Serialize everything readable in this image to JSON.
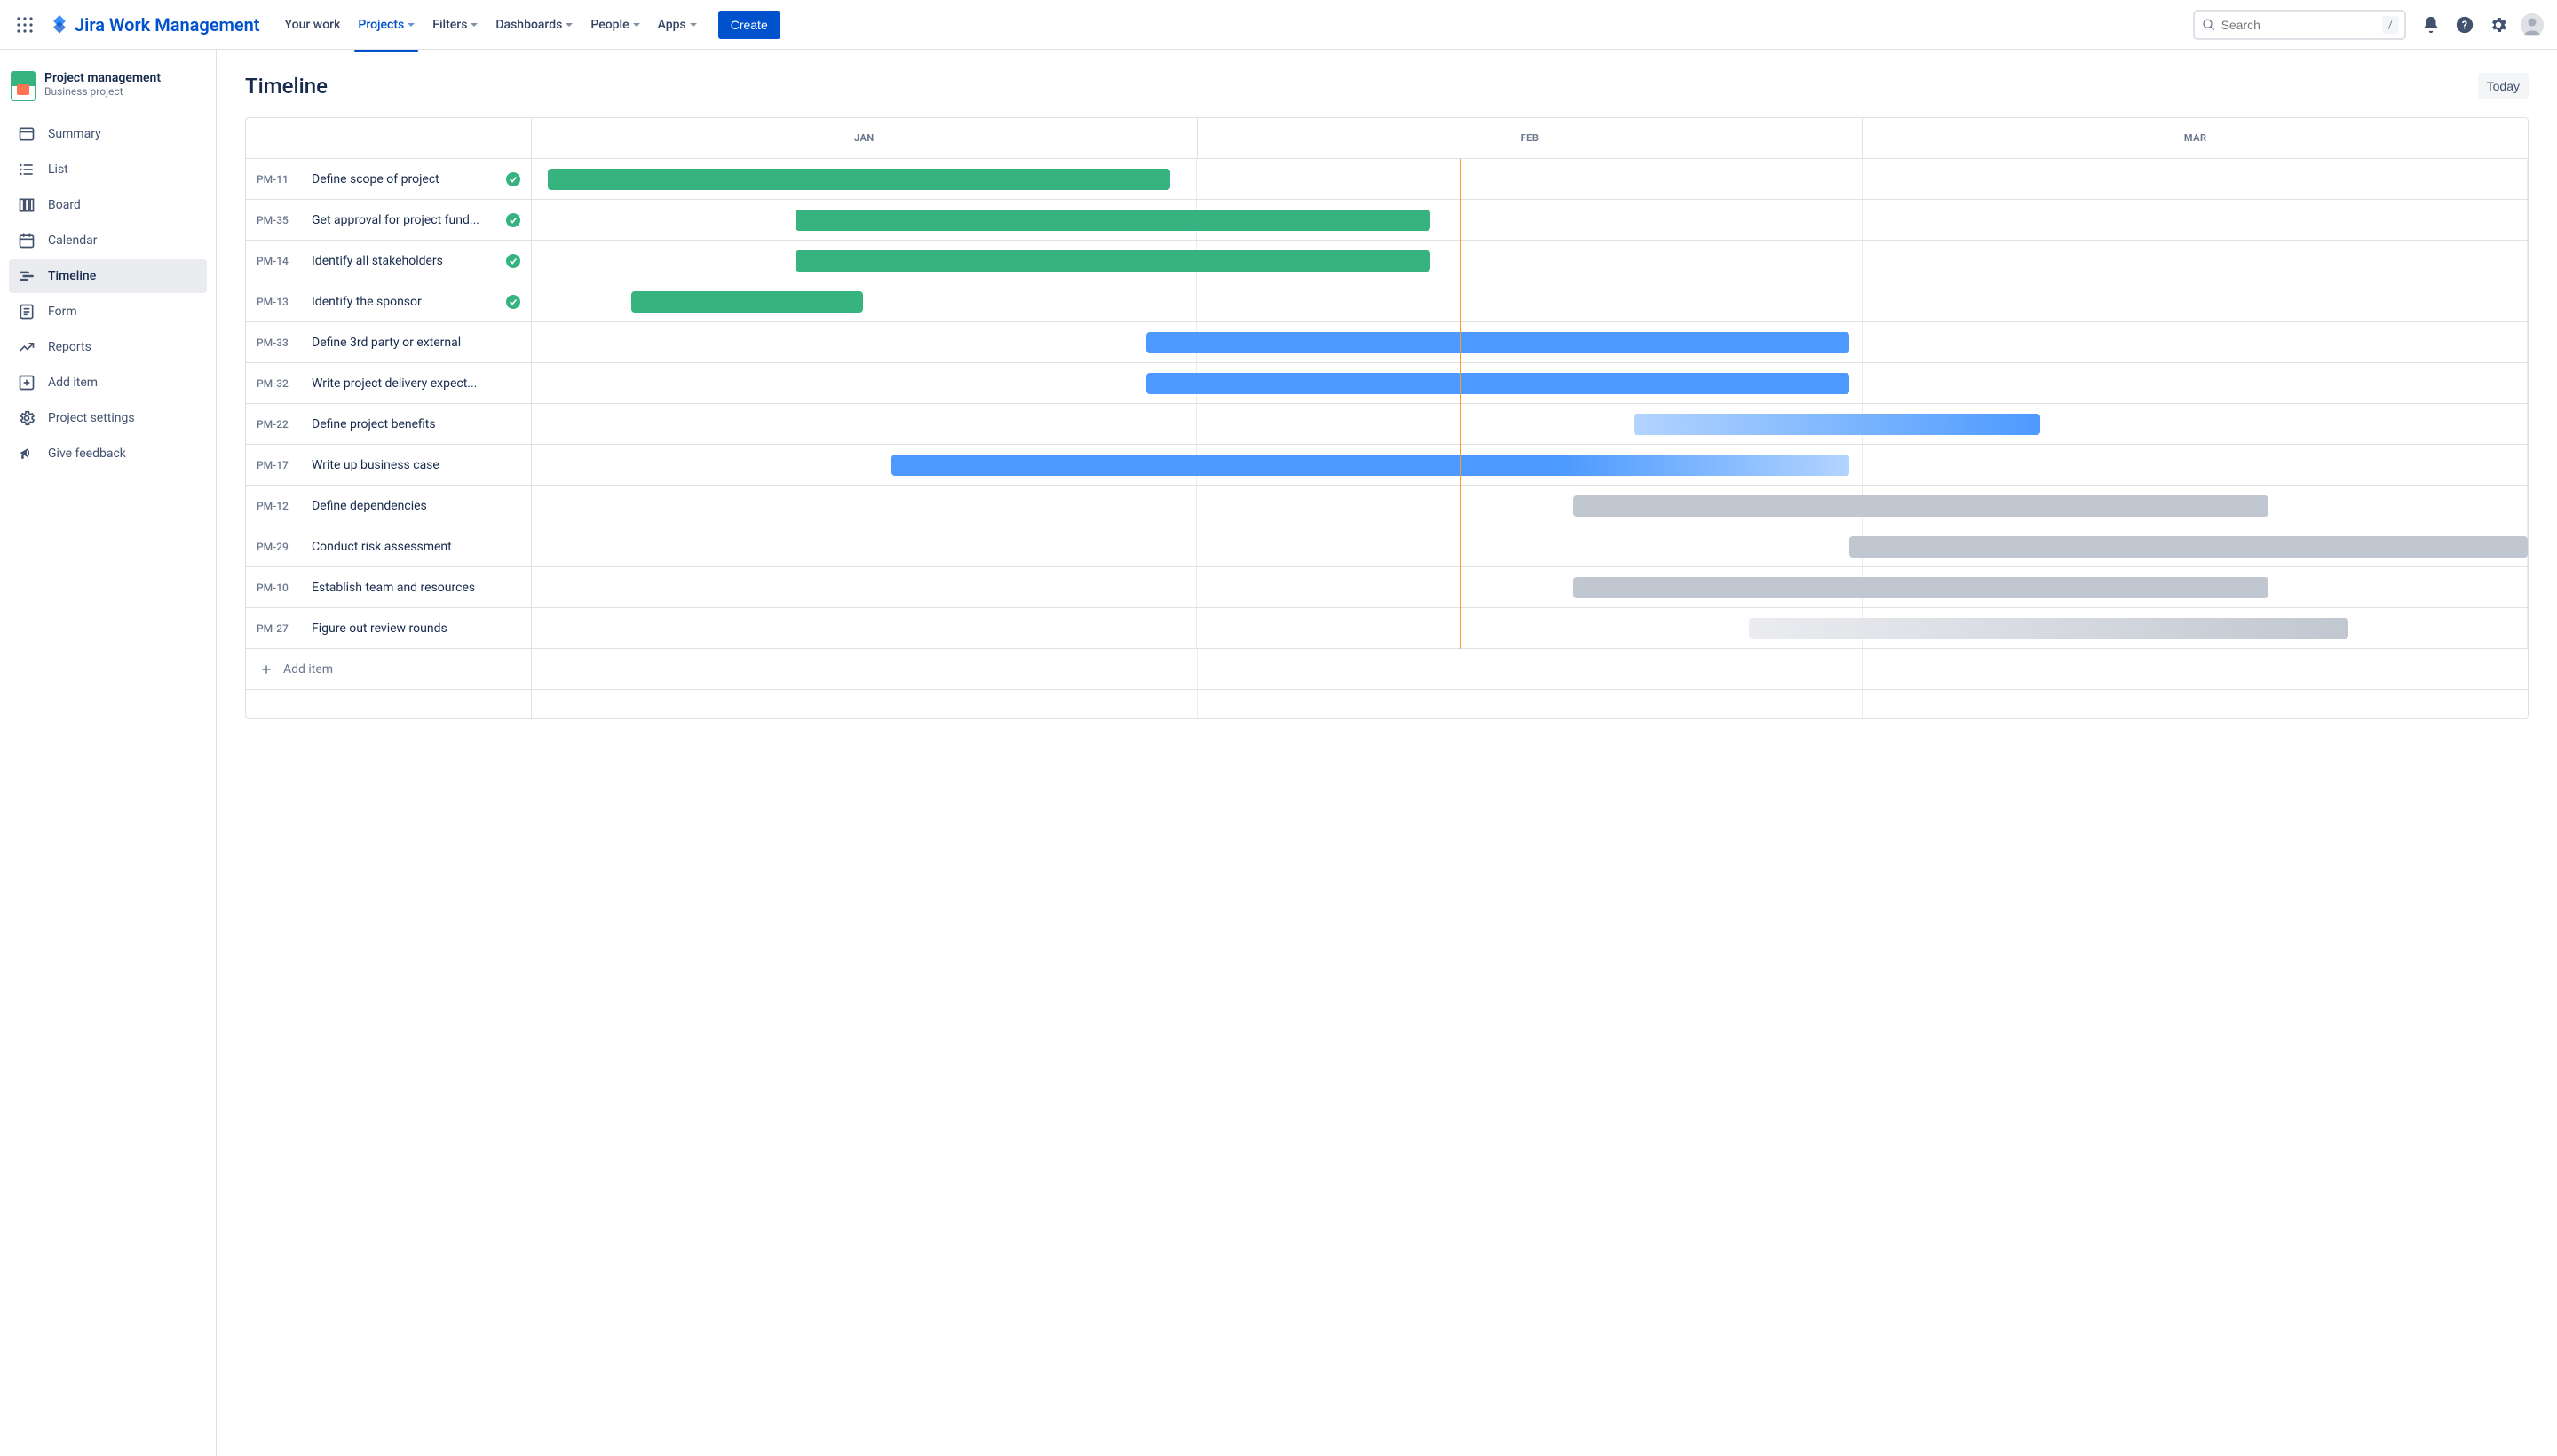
{
  "topbar": {
    "product_name": "Jira Work Management",
    "nav": [
      {
        "label": "Your work",
        "active": false,
        "dropdown": false
      },
      {
        "label": "Projects",
        "active": true,
        "dropdown": true
      },
      {
        "label": "Filters",
        "active": false,
        "dropdown": true
      },
      {
        "label": "Dashboards",
        "active": false,
        "dropdown": true
      },
      {
        "label": "People",
        "active": false,
        "dropdown": true
      },
      {
        "label": "Apps",
        "active": false,
        "dropdown": true
      }
    ],
    "create_label": "Create",
    "search_placeholder": "Search",
    "search_shortcut": "/"
  },
  "sidebar": {
    "project_name": "Project management",
    "project_type": "Business project",
    "items": [
      {
        "label": "Summary",
        "icon": "summary"
      },
      {
        "label": "List",
        "icon": "list"
      },
      {
        "label": "Board",
        "icon": "board"
      },
      {
        "label": "Calendar",
        "icon": "calendar"
      },
      {
        "label": "Timeline",
        "icon": "timeline",
        "active": true
      },
      {
        "label": "Form",
        "icon": "form"
      },
      {
        "label": "Reports",
        "icon": "reports"
      },
      {
        "label": "Add item",
        "icon": "add"
      },
      {
        "label": "Project settings",
        "icon": "settings"
      },
      {
        "label": "Give feedback",
        "icon": "feedback"
      }
    ]
  },
  "main": {
    "title": "Timeline",
    "today_label": "Today",
    "months": [
      "JAN",
      "FEB",
      "MAR"
    ],
    "today_position_pct": 46.5,
    "tasks": [
      {
        "id": "PM-11",
        "name": "Define scope of project",
        "done": true,
        "bar": {
          "color": "green",
          "start": 0.8,
          "end": 32
        }
      },
      {
        "id": "PM-35",
        "name": "Get approval for project fund...",
        "done": true,
        "bar": {
          "color": "green",
          "start": 13.2,
          "end": 45.0
        }
      },
      {
        "id": "PM-14",
        "name": "Identify all stakeholders",
        "done": true,
        "bar": {
          "color": "green",
          "start": 13.2,
          "end": 45.0
        }
      },
      {
        "id": "PM-13",
        "name": "Identify the sponsor",
        "done": true,
        "bar": {
          "color": "green",
          "start": 5.0,
          "end": 16.6
        }
      },
      {
        "id": "PM-33",
        "name": "Define 3rd party or external",
        "done": false,
        "bar": {
          "color": "blue",
          "start": 30.8,
          "end": 66.0
        }
      },
      {
        "id": "PM-32",
        "name": "Write project delivery expect...",
        "done": false,
        "bar": {
          "color": "blue",
          "start": 30.8,
          "end": 66.0
        }
      },
      {
        "id": "PM-22",
        "name": "Define project benefits",
        "done": false,
        "bar": {
          "color": "blue-fade",
          "start": 55.2,
          "end": 75.6
        }
      },
      {
        "id": "PM-17",
        "name": "Write up business case",
        "done": false,
        "bar": {
          "color": "blue-fadeout",
          "start": 18.0,
          "end": 66.0
        }
      },
      {
        "id": "PM-12",
        "name": "Define dependencies",
        "done": false,
        "bar": {
          "color": "grey",
          "start": 52.2,
          "end": 87.0
        }
      },
      {
        "id": "PM-29",
        "name": "Conduct risk assessment",
        "done": false,
        "bar": {
          "color": "grey",
          "start": 66.0,
          "end": 100.0
        }
      },
      {
        "id": "PM-10",
        "name": "Establish team and resources",
        "done": false,
        "bar": {
          "color": "grey",
          "start": 52.2,
          "end": 87.0
        }
      },
      {
        "id": "PM-27",
        "name": "Figure out review rounds",
        "done": false,
        "bar": {
          "color": "grey-fade",
          "start": 61.0,
          "end": 91.0
        }
      }
    ],
    "add_item_label": "Add item"
  }
}
